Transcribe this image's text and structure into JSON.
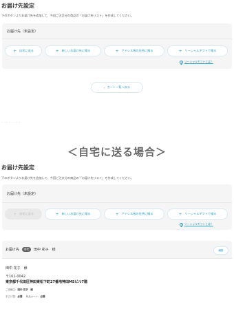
{
  "top": {
    "title": "お届け先設定",
    "description": "下のボタンよりお届け先を追加して、今回ご注文分の商品の「お届け先リスト」を作成してください。",
    "panel_label": "お届け先（未設定）",
    "buttons": [
      "自宅に送る",
      "新しいお届け先に贈る",
      "アドレス帳の住所に贈る",
      "ソーシャルギフトで贈る"
    ],
    "gift_link": "ソーシャルギフトとは？",
    "back_button": "カート一覧へ戻る"
  },
  "dots": "・・・・・・・・",
  "case_heading": "＜自宅に送る場合＞",
  "bottom": {
    "title": "お届け先設定",
    "description": "下のボタンよりお届け先を追加して、今回ご注文分の商品の「お届け先リスト」を作成してください。",
    "panel_label": "お届け先（未設定）",
    "buttons": [
      "自宅に送る",
      "新しいお届け先に贈る",
      "アドレス帳の住所に贈る",
      "ソーシャルギフトで贈る"
    ],
    "gift_link": "ソーシャルギフトとは？",
    "recipient": {
      "label": "お届け先",
      "badge": "自宅",
      "name": "田中 花子　様",
      "edit": "編集",
      "addr_name": "田中 花子　様",
      "postal": "〒101-0042",
      "address": "東京都千代田区神田東松下町27番地神田MSビル7階",
      "meta1_label": "ご依頼主：",
      "meta1_value": "田中 花子　様",
      "meta2_label": "手さげ袋：",
      "meta2_value": "必要",
      "meta3_label": "商品カード：",
      "meta3_value": "必要"
    }
  }
}
